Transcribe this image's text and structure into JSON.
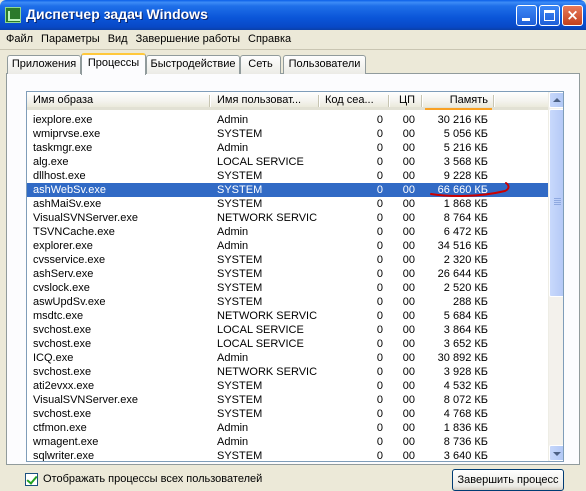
{
  "window": {
    "title": "Диспетчер задач Windows",
    "buttons": {
      "minimize": "minimize-icon",
      "maximize": "maximize-icon",
      "close": "×"
    }
  },
  "menu": [
    "Файл",
    "Параметры",
    "Вид",
    "Завершение работы",
    "Справка"
  ],
  "tabs": [
    {
      "label": "Приложения",
      "active": false
    },
    {
      "label": "Процессы",
      "active": true
    },
    {
      "label": "Быстродействие",
      "active": false
    },
    {
      "label": "Сеть",
      "active": false
    },
    {
      "label": "Пользователи",
      "active": false
    }
  ],
  "table": {
    "columns": [
      "Имя образа",
      "Имя пользоват...",
      "Код сеа...",
      "ЦП",
      "Память"
    ],
    "sorted_column": "Память",
    "selected_row": "ashWebSv.exe",
    "rows": [
      [
        "iexplore.exe",
        "Admin",
        "0",
        "00",
        "30 216 КБ"
      ],
      [
        "wmiprvse.exe",
        "SYSTEM",
        "0",
        "00",
        "5 056 КБ"
      ],
      [
        "taskmgr.exe",
        "Admin",
        "0",
        "00",
        "5 216 КБ"
      ],
      [
        "alg.exe",
        "LOCAL SERVICE",
        "0",
        "00",
        "3 568 КБ"
      ],
      [
        "dllhost.exe",
        "SYSTEM",
        "0",
        "00",
        "9 228 КБ"
      ],
      [
        "ashWebSv.exe",
        "SYSTEM",
        "0",
        "00",
        "66 660 КБ"
      ],
      [
        "ashMaiSv.exe",
        "SYSTEM",
        "0",
        "00",
        "1 868 КБ"
      ],
      [
        "VisualSVNServer.exe",
        "NETWORK SERVICE",
        "0",
        "00",
        "8 764 КБ"
      ],
      [
        "TSVNCache.exe",
        "Admin",
        "0",
        "00",
        "6 472 КБ"
      ],
      [
        "explorer.exe",
        "Admin",
        "0",
        "00",
        "34 516 КБ"
      ],
      [
        "cvsservice.exe",
        "SYSTEM",
        "0",
        "00",
        "2 320 КБ"
      ],
      [
        "ashServ.exe",
        "SYSTEM",
        "0",
        "00",
        "26 644 КБ"
      ],
      [
        "cvslock.exe",
        "SYSTEM",
        "0",
        "00",
        "2 520 КБ"
      ],
      [
        "aswUpdSv.exe",
        "SYSTEM",
        "0",
        "00",
        "288 КБ"
      ],
      [
        "msdtc.exe",
        "NETWORK SERVICE",
        "0",
        "00",
        "5 684 КБ"
      ],
      [
        "svchost.exe",
        "LOCAL SERVICE",
        "0",
        "00",
        "3 864 КБ"
      ],
      [
        "svchost.exe",
        "LOCAL SERVICE",
        "0",
        "00",
        "3 652 КБ"
      ],
      [
        "ICQ.exe",
        "Admin",
        "0",
        "00",
        "30 892 КБ"
      ],
      [
        "svchost.exe",
        "NETWORK SERVICE",
        "0",
        "00",
        "3 928 КБ"
      ],
      [
        "ati2evxx.exe",
        "SYSTEM",
        "0",
        "00",
        "4 532 КБ"
      ],
      [
        "VisualSVNServer.exe",
        "SYSTEM",
        "0",
        "00",
        "8 072 КБ"
      ],
      [
        "svchost.exe",
        "SYSTEM",
        "0",
        "00",
        "4 768 КБ"
      ],
      [
        "ctfmon.exe",
        "Admin",
        "0",
        "00",
        "1 836 КБ"
      ],
      [
        "wmagent.exe",
        "Admin",
        "0",
        "00",
        "8 736 КБ"
      ],
      [
        "sqlwriter.exe",
        "SYSTEM",
        "0",
        "00",
        "3 640 КБ"
      ]
    ]
  },
  "show_all_users": {
    "label": "Отображать процессы всех пользователей",
    "checked": true
  },
  "end_process_button": "Завершить процесс",
  "colors": {
    "selection": "#316ac5",
    "annotation": "#cc0000",
    "sort_indicator": "#f9a123"
  }
}
